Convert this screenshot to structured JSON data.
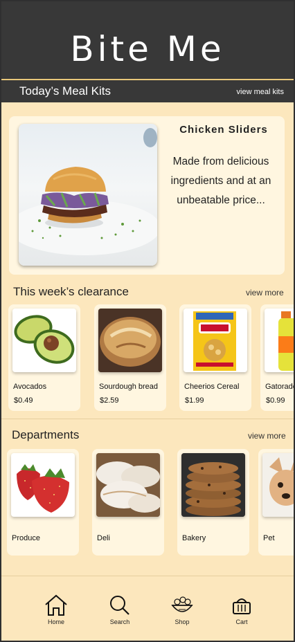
{
  "app": {
    "brand": "Bite Me"
  },
  "meal_kits": {
    "title": "Today’s Meal Kits",
    "link": "view meal kits",
    "featured": {
      "image": "chicken-slider-photo",
      "title": "Chicken  Sliders",
      "description": "Made from delicious ingredients and at an unbeatable price..."
    }
  },
  "clearance": {
    "title": "This week’s clearance",
    "link": "view more",
    "items": [
      {
        "name": "Avocados",
        "price": "$0.49",
        "image": "avocado-photo"
      },
      {
        "name": "Sourdough bread",
        "price": "$2.59",
        "image": "bread-photo"
      },
      {
        "name": "Cheerios Cereal",
        "price": "$1.99",
        "image": "cereal-box-photo"
      },
      {
        "name": "Gatorade",
        "price": "$0.99",
        "image": "gatorade-photo"
      }
    ]
  },
  "departments": {
    "title": "Departments",
    "link": "view more",
    "items": [
      {
        "name": "Produce",
        "image": "strawberries-photo"
      },
      {
        "name": "Deli",
        "image": "sliced-turkey-photo"
      },
      {
        "name": "Bakery",
        "image": "cookies-photo"
      },
      {
        "name": "Pet",
        "image": "dog-photo"
      }
    ]
  },
  "nav": {
    "items": [
      {
        "label": "Home",
        "icon": "home-icon"
      },
      {
        "label": "Search",
        "icon": "search-icon"
      },
      {
        "label": "Shop",
        "icon": "shop-bowl-icon"
      },
      {
        "label": "Cart",
        "icon": "cart-icon"
      }
    ]
  },
  "colors": {
    "header": "#383838",
    "background": "#fce7bd",
    "card": "#fff6e0",
    "accent": "#e9c87a"
  }
}
